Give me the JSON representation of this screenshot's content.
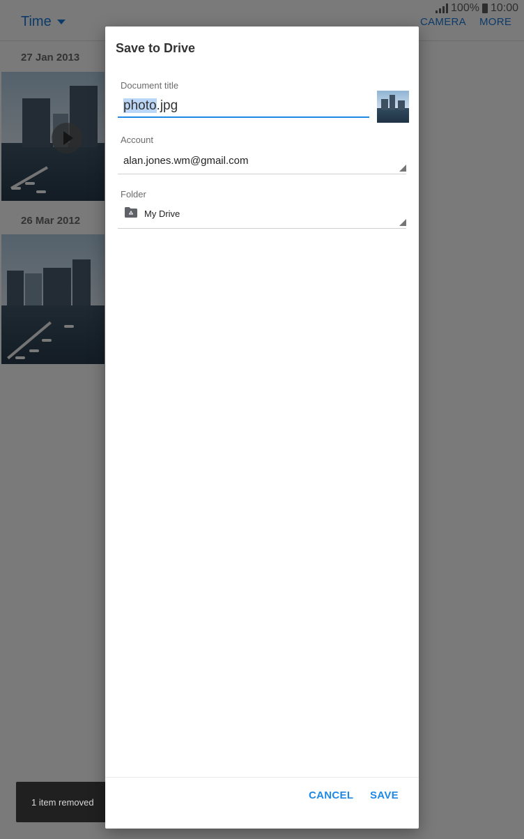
{
  "status_bar": {
    "battery": "100%",
    "clock": "10:00"
  },
  "gallery": {
    "filter_label": "Time",
    "camera_label": "CAMERA",
    "more_label": "MORE",
    "groups": [
      {
        "date": "27 Jan 2013"
      },
      {
        "date": "26 Mar 2012"
      }
    ],
    "toast": "1 item removed"
  },
  "dialog": {
    "title": "Save to Drive",
    "document_title": {
      "label": "Document title",
      "selected_part": "photo",
      "rest": ".jpg"
    },
    "account": {
      "label": "Account",
      "value": "alan.jones.wm@gmail.com"
    },
    "folder": {
      "label": "Folder",
      "value": "My Drive"
    },
    "buttons": {
      "cancel": "CANCEL",
      "save": "SAVE"
    }
  },
  "colors": {
    "accent": "#1e88e5",
    "selection": "#bcd6f7"
  }
}
